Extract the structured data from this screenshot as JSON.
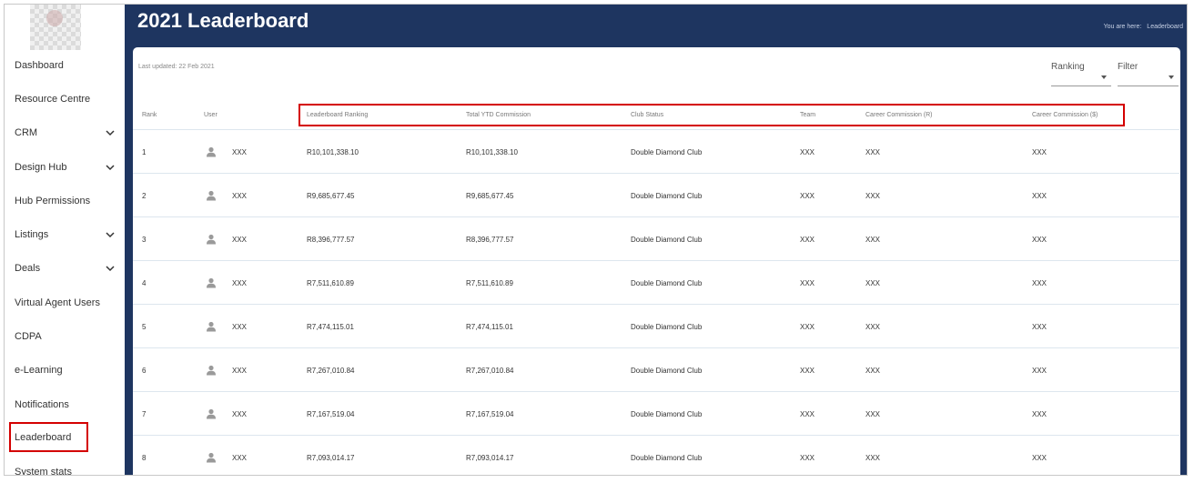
{
  "sidebar": {
    "items": [
      {
        "label": "Dashboard",
        "has_chevron": false,
        "active": false
      },
      {
        "label": "Resource Centre",
        "has_chevron": false,
        "active": false
      },
      {
        "label": "CRM",
        "has_chevron": true,
        "active": false
      },
      {
        "label": "Design Hub",
        "has_chevron": true,
        "active": false
      },
      {
        "label": "Hub Permissions",
        "has_chevron": false,
        "active": false
      },
      {
        "label": "Listings",
        "has_chevron": true,
        "active": false
      },
      {
        "label": "Deals",
        "has_chevron": true,
        "active": false
      },
      {
        "label": "Virtual Agent Users",
        "has_chevron": false,
        "active": false
      },
      {
        "label": "CDPA",
        "has_chevron": false,
        "active": false
      },
      {
        "label": "e-Learning",
        "has_chevron": false,
        "active": false
      },
      {
        "label": "Notifications",
        "has_chevron": false,
        "active": false
      },
      {
        "label": "Leaderboard",
        "has_chevron": false,
        "active": true
      },
      {
        "label": "System stats",
        "has_chevron": false,
        "active": false
      }
    ]
  },
  "header": {
    "title": "2021 Leaderboard",
    "breadcrumb_prefix": "You are here:",
    "breadcrumb_current": "Leaderboard"
  },
  "card": {
    "last_updated": "Last updated: 22 Feb 2021",
    "ranking_select": "Ranking",
    "filter_select": "Filter"
  },
  "table": {
    "columns": {
      "rank": "Rank",
      "user": "User",
      "leaderboard_ranking": "Leaderboard Ranking",
      "total_ytd": "Total YTD Commission",
      "club_status": "Club Status",
      "team": "Team",
      "career_r": "Career Commission (R)",
      "career_usd": "Career Commission ($)"
    },
    "rows": [
      {
        "rank": "1",
        "user": "XXX",
        "leaderboard_ranking": "R10,101,338.10",
        "total_ytd": "R10,101,338.10",
        "club_status": "Double Diamond Club",
        "team": "XXX",
        "career_r": "XXX",
        "career_usd": "XXX"
      },
      {
        "rank": "2",
        "user": "XXX",
        "leaderboard_ranking": "R9,685,677.45",
        "total_ytd": "R9,685,677.45",
        "club_status": "Double Diamond Club",
        "team": "XXX",
        "career_r": "XXX",
        "career_usd": "XXX"
      },
      {
        "rank": "3",
        "user": "XXX",
        "leaderboard_ranking": "R8,396,777.57",
        "total_ytd": "R8,396,777.57",
        "club_status": "Double Diamond Club",
        "team": "XXX",
        "career_r": "XXX",
        "career_usd": "XXX"
      },
      {
        "rank": "4",
        "user": "XXX",
        "leaderboard_ranking": "R7,511,610.89",
        "total_ytd": "R7,511,610.89",
        "club_status": "Double Diamond Club",
        "team": "XXX",
        "career_r": "XXX",
        "career_usd": "XXX"
      },
      {
        "rank": "5",
        "user": "XXX",
        "leaderboard_ranking": "R7,474,115.01",
        "total_ytd": "R7,474,115.01",
        "club_status": "Double Diamond Club",
        "team": "XXX",
        "career_r": "XXX",
        "career_usd": "XXX"
      },
      {
        "rank": "6",
        "user": "XXX",
        "leaderboard_ranking": "R7,267,010.84",
        "total_ytd": "R7,267,010.84",
        "club_status": "Double Diamond Club",
        "team": "XXX",
        "career_r": "XXX",
        "career_usd": "XXX"
      },
      {
        "rank": "7",
        "user": "XXX",
        "leaderboard_ranking": "R7,167,519.04",
        "total_ytd": "R7,167,519.04",
        "club_status": "Double Diamond Club",
        "team": "XXX",
        "career_r": "XXX",
        "career_usd": "XXX"
      },
      {
        "rank": "8",
        "user": "XXX",
        "leaderboard_ranking": "R7,093,014.17",
        "total_ytd": "R7,093,014.17",
        "club_status": "Double Diamond Club",
        "team": "XXX",
        "career_r": "XXX",
        "career_usd": "XXX"
      }
    ]
  },
  "colors": {
    "header_bg": "#1e3560",
    "highlight": "#d40000",
    "text": "#333333"
  },
  "icons": {
    "user": "person-icon",
    "chevron": "chevron-down-icon",
    "caret": "caret-down-icon"
  }
}
